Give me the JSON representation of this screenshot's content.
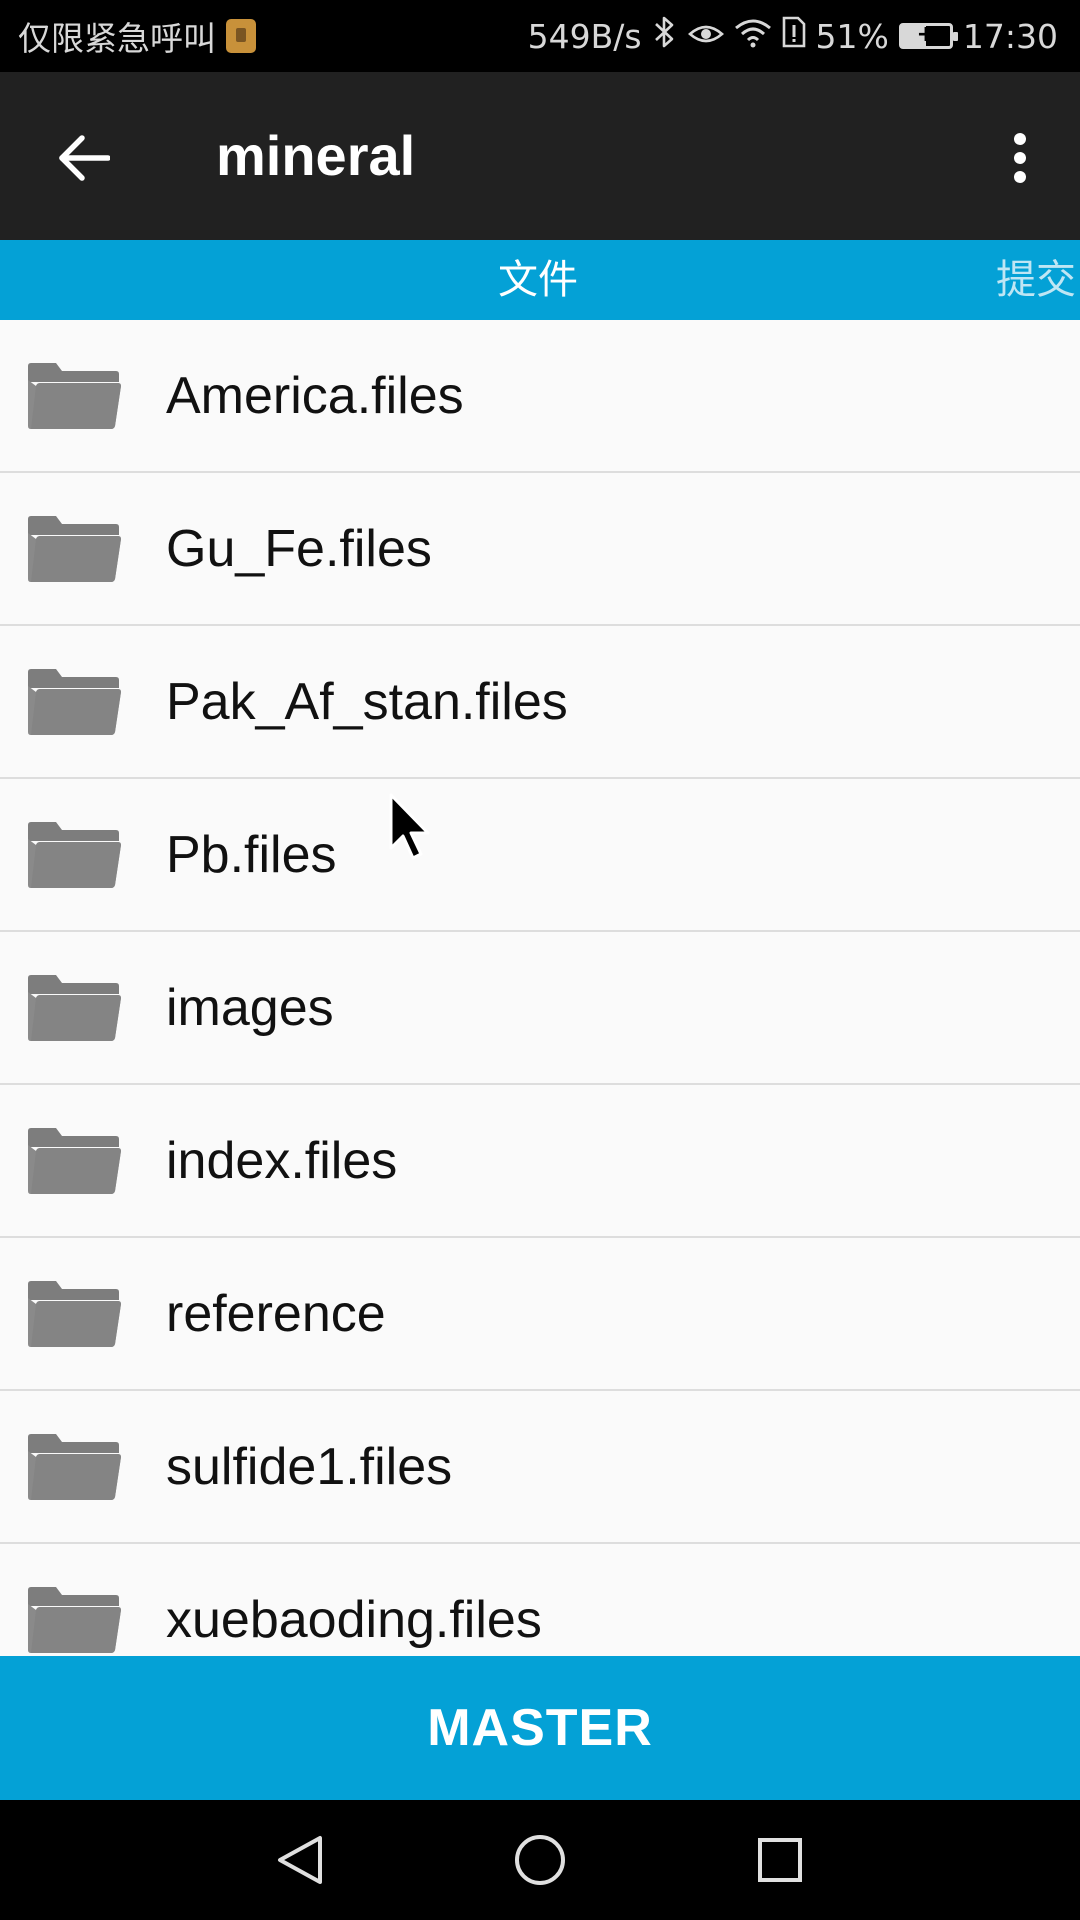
{
  "status_bar": {
    "carrier_text": "仅限紧急呼叫",
    "net_speed": "549B/s",
    "battery_percent": "51%",
    "battery_level": 0.51,
    "time": "17:30",
    "icons": [
      "sim-icon",
      "bluetooth-icon",
      "eye-icon",
      "wifi-icon",
      "sim-alert-icon",
      "battery-charging-icon"
    ]
  },
  "app_bar": {
    "title": "mineral",
    "back_icon": "arrow-left-icon",
    "menu_icon": "more-vert-icon"
  },
  "tabs": [
    {
      "label": "文件",
      "active": true
    },
    {
      "label": "提交",
      "active": false
    }
  ],
  "files": [
    {
      "name": "America.files",
      "icon": "folder-icon"
    },
    {
      "name": "Gu_Fe.files",
      "icon": "folder-icon"
    },
    {
      "name": "Pak_Af_stan.files",
      "icon": "folder-icon"
    },
    {
      "name": "Pb.files",
      "icon": "folder-icon"
    },
    {
      "name": "images",
      "icon": "folder-icon"
    },
    {
      "name": "index.files",
      "icon": "folder-icon"
    },
    {
      "name": "reference",
      "icon": "folder-icon"
    },
    {
      "name": "sulfide1.files",
      "icon": "folder-icon"
    },
    {
      "name": "xuebaoding.files",
      "icon": "folder-icon"
    }
  ],
  "branch_button": {
    "label": "MASTER"
  },
  "colors": {
    "accent": "#04a1d6",
    "app_bar": "#212121",
    "folder": "#808080"
  },
  "nav_bar": {
    "icons": [
      "nav-back-icon",
      "nav-home-icon",
      "nav-recents-icon"
    ]
  }
}
